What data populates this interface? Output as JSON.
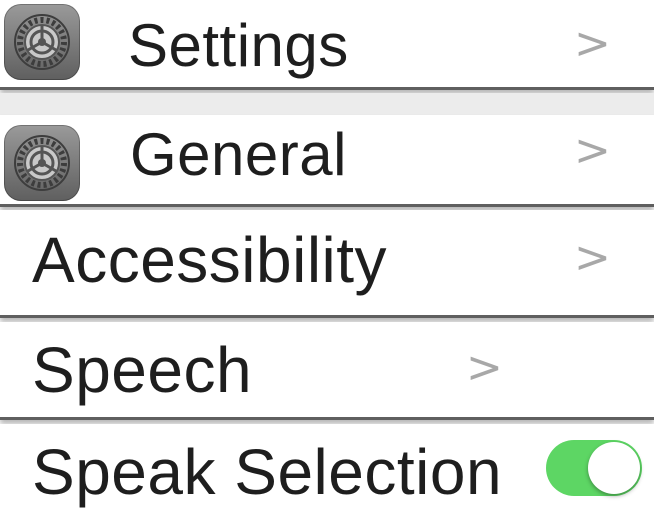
{
  "rows": {
    "settings": {
      "label": "Settings",
      "icon": "settings-gear-icon",
      "chevron": ">"
    },
    "general": {
      "label": "General",
      "icon": "settings-gear-icon",
      "chevron": ">"
    },
    "accessibility": {
      "label": "Accessibility",
      "chevron": ">"
    },
    "speech": {
      "label": "Speech",
      "chevron": ">"
    },
    "speak_selection": {
      "label": "Speak Selection",
      "toggle_on": true
    }
  },
  "colors": {
    "toggle_on": "#5dd664",
    "chevron": "#a8a8a8",
    "text": "#1e1e1e",
    "icon_gray": "#7a7a7a"
  }
}
